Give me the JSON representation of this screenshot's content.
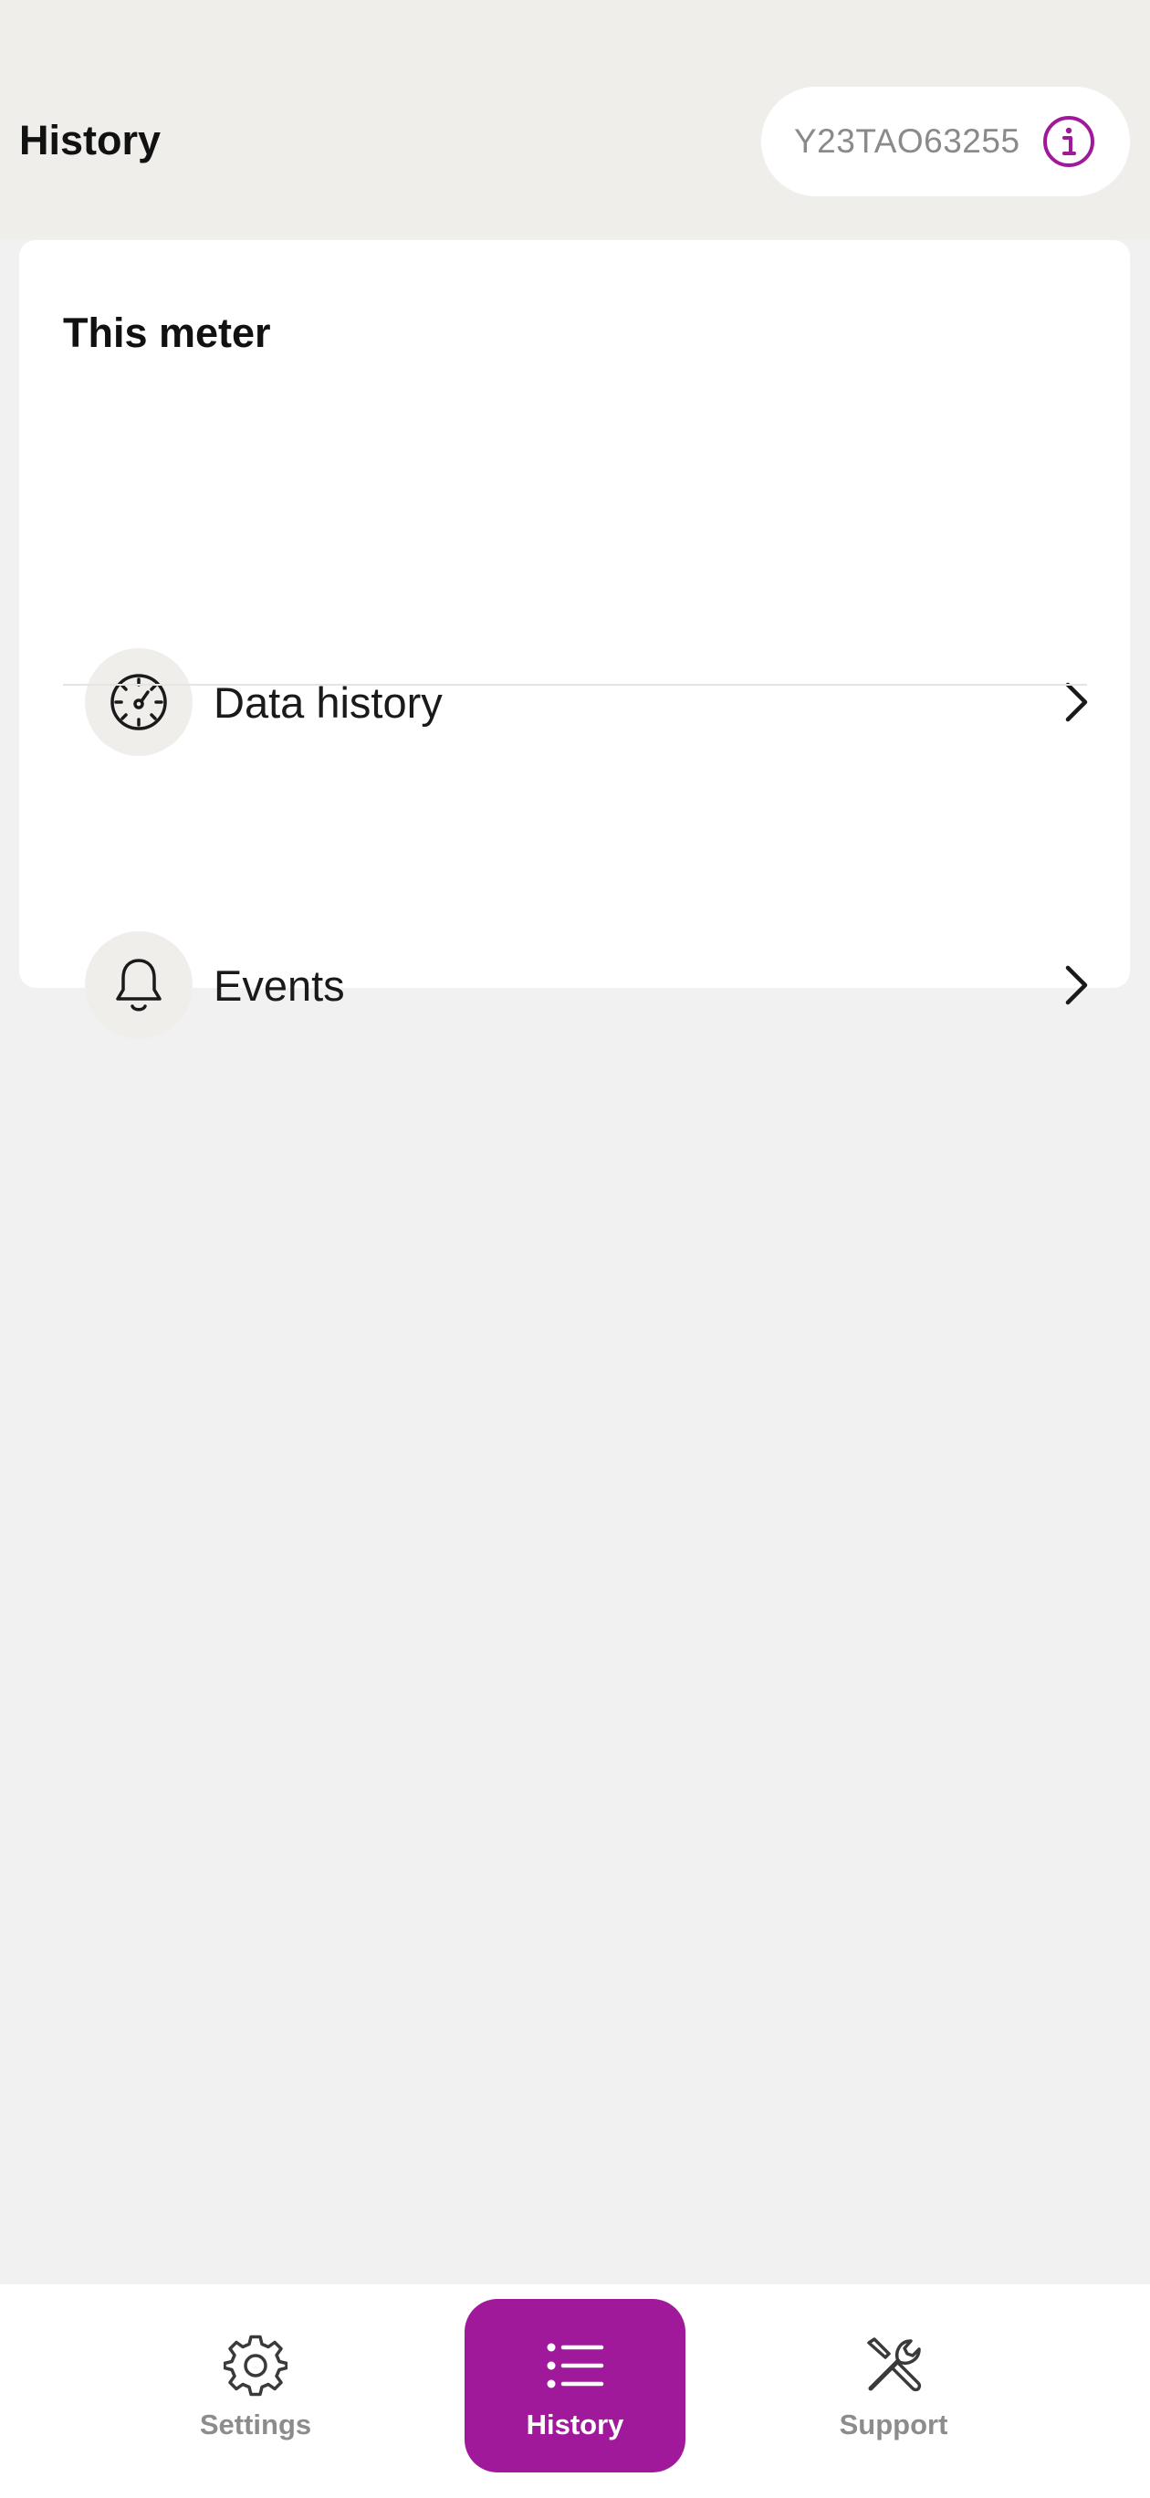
{
  "header": {
    "title": "History",
    "meter_id": "Y23TAO63255",
    "info_icon": "info-icon",
    "accent_color": "#a0199a"
  },
  "card": {
    "title": "This meter",
    "items": [
      {
        "label": "Data history",
        "icon": "gauge-icon"
      },
      {
        "label": "Events",
        "icon": "bell-icon"
      }
    ]
  },
  "bottom_nav": {
    "items": [
      {
        "label": "Settings",
        "icon": "gear-icon",
        "active": false
      },
      {
        "label": "History",
        "icon": "list-icon",
        "active": true
      },
      {
        "label": "Support",
        "icon": "tools-icon",
        "active": false
      }
    ]
  }
}
